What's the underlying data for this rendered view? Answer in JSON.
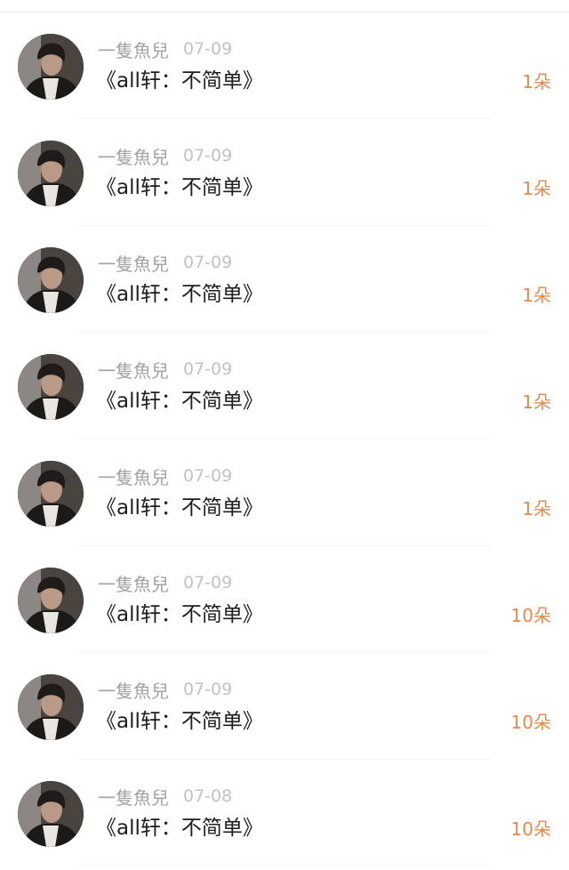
{
  "items": [
    {
      "user": "一隻魚兒",
      "date": "07-09",
      "title": "《all轩：不简单》",
      "count": "1朵"
    },
    {
      "user": "一隻魚兒",
      "date": "07-09",
      "title": "《all轩：不简单》",
      "count": "1朵"
    },
    {
      "user": "一隻魚兒",
      "date": "07-09",
      "title": "《all轩：不简单》",
      "count": "1朵"
    },
    {
      "user": "一隻魚兒",
      "date": "07-09",
      "title": "《all轩：不简单》",
      "count": "1朵"
    },
    {
      "user": "一隻魚兒",
      "date": "07-09",
      "title": "《all轩：不简单》",
      "count": "1朵"
    },
    {
      "user": "一隻魚兒",
      "date": "07-09",
      "title": "《all轩：不简单》",
      "count": "10朵"
    },
    {
      "user": "一隻魚兒",
      "date": "07-09",
      "title": "《all轩：不简单》",
      "count": "10朵"
    },
    {
      "user": "一隻魚兒",
      "date": "07-08",
      "title": "《all轩：不简单》",
      "count": "10朵"
    }
  ],
  "colors": {
    "accent": "#e8884a",
    "name_text": "#a3a3a3",
    "date_text": "#c2c2c2",
    "title_text": "#1e1e1e"
  }
}
